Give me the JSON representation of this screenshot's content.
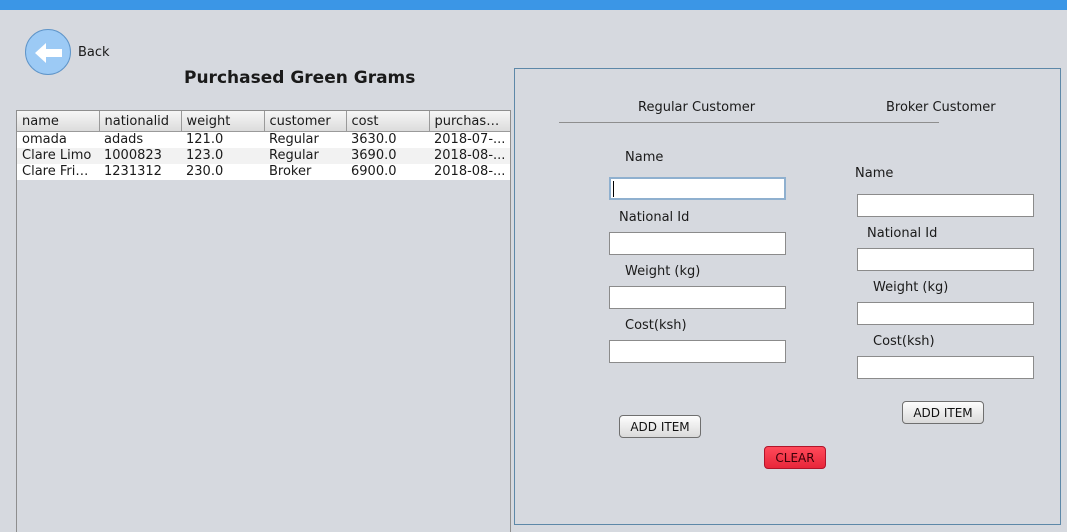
{
  "window": {
    "accent": "#3b96e6"
  },
  "nav": {
    "back_label": "Back",
    "back_icon": "arrow-left-icon"
  },
  "page": {
    "title": "Purchased Green Grams"
  },
  "table": {
    "columns": [
      "name",
      "nationalid",
      "weight",
      "customer",
      "cost",
      "purchase..."
    ],
    "rows": [
      [
        "omada",
        "adads",
        "121.0",
        "Regular",
        "3630.0",
        "2018-07-..."
      ],
      [
        "Clare Limo",
        "1000823",
        "123.0",
        "Regular",
        "3690.0",
        "2018-08-..."
      ],
      [
        "Clare Frie...",
        "1231312",
        "230.0",
        "Broker",
        "6900.0",
        "2018-08-..."
      ]
    ]
  },
  "regular": {
    "header": "Regular Customer",
    "name_label": "Name",
    "name_value": "",
    "national_id_label": "National Id",
    "national_id_value": "",
    "weight_label": "Weight (kg)",
    "weight_value": "",
    "cost_label": "Cost(ksh)",
    "cost_value": "",
    "add_label": "ADD ITEM"
  },
  "broker": {
    "header": "Broker Customer",
    "name_label": "Name",
    "name_value": "",
    "national_id_label": "National Id",
    "national_id_value": "",
    "weight_label": "Weight (kg)",
    "weight_value": "",
    "cost_label": "Cost(ksh)",
    "cost_value": "",
    "add_label": "ADD ITEM"
  },
  "actions": {
    "clear_label": "CLEAR",
    "clear_color": "#f0283c"
  }
}
